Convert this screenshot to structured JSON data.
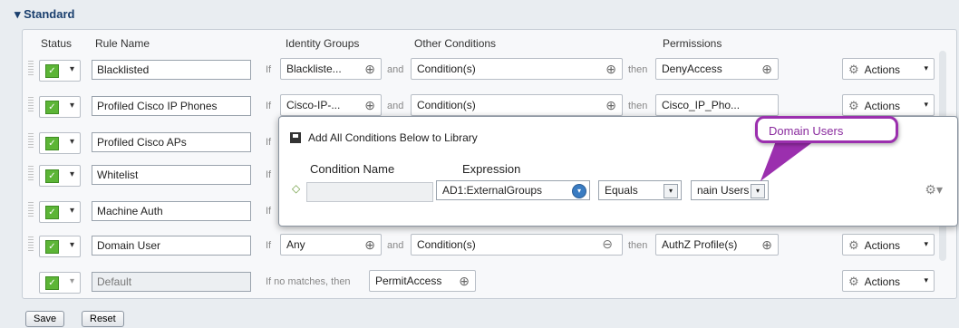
{
  "section": {
    "title": "▾ Standard"
  },
  "columns": {
    "status": "Status",
    "rule_name": "Rule Name",
    "identity_groups": "Identity Groups",
    "other_conditions": "Other Conditions",
    "permissions": "Permissions"
  },
  "keywords": {
    "if": "If",
    "and": "and",
    "then": "then",
    "if_no_matches": "If no matches, then"
  },
  "rows": [
    {
      "name": "Blacklisted",
      "identity": "Blackliste...",
      "condition": "Condition(s)",
      "permission": "DenyAccess",
      "actions": "Actions"
    },
    {
      "name": "Profiled Cisco IP Phones",
      "identity": "Cisco-IP-...",
      "condition": "Condition(s)",
      "permission": "Cisco_IP_Pho...",
      "actions": "Actions"
    },
    {
      "name": "Profiled Cisco APs"
    },
    {
      "name": "Whitelist"
    },
    {
      "name": "Machine Auth"
    },
    {
      "name": "Domain User",
      "identity": "Any",
      "condition": "Condition(s)",
      "permission": "AuthZ Profile(s)",
      "actions": "Actions"
    },
    {
      "name": "Default",
      "permission": "PermitAccess",
      "actions": "Actions"
    }
  ],
  "overlay": {
    "title": "Add All Conditions Below to Library",
    "condition_name_header": "Condition Name",
    "expression_header": "Expression",
    "condition_name_value": "",
    "attribute": "AD1:ExternalGroups",
    "operator": "Equals",
    "value": "nain Users"
  },
  "tooltip": {
    "text": "Domain Users"
  },
  "buttons": {
    "save": "Save",
    "reset": "Reset"
  },
  "colors": {
    "check_green": "#5cb536",
    "tooltip_purple": "#9b2fae",
    "section_blue": "#1a3f6e"
  },
  "icons": {
    "check": "✓",
    "chevron": "▾",
    "plus": "⊕",
    "gear": "⚙"
  }
}
